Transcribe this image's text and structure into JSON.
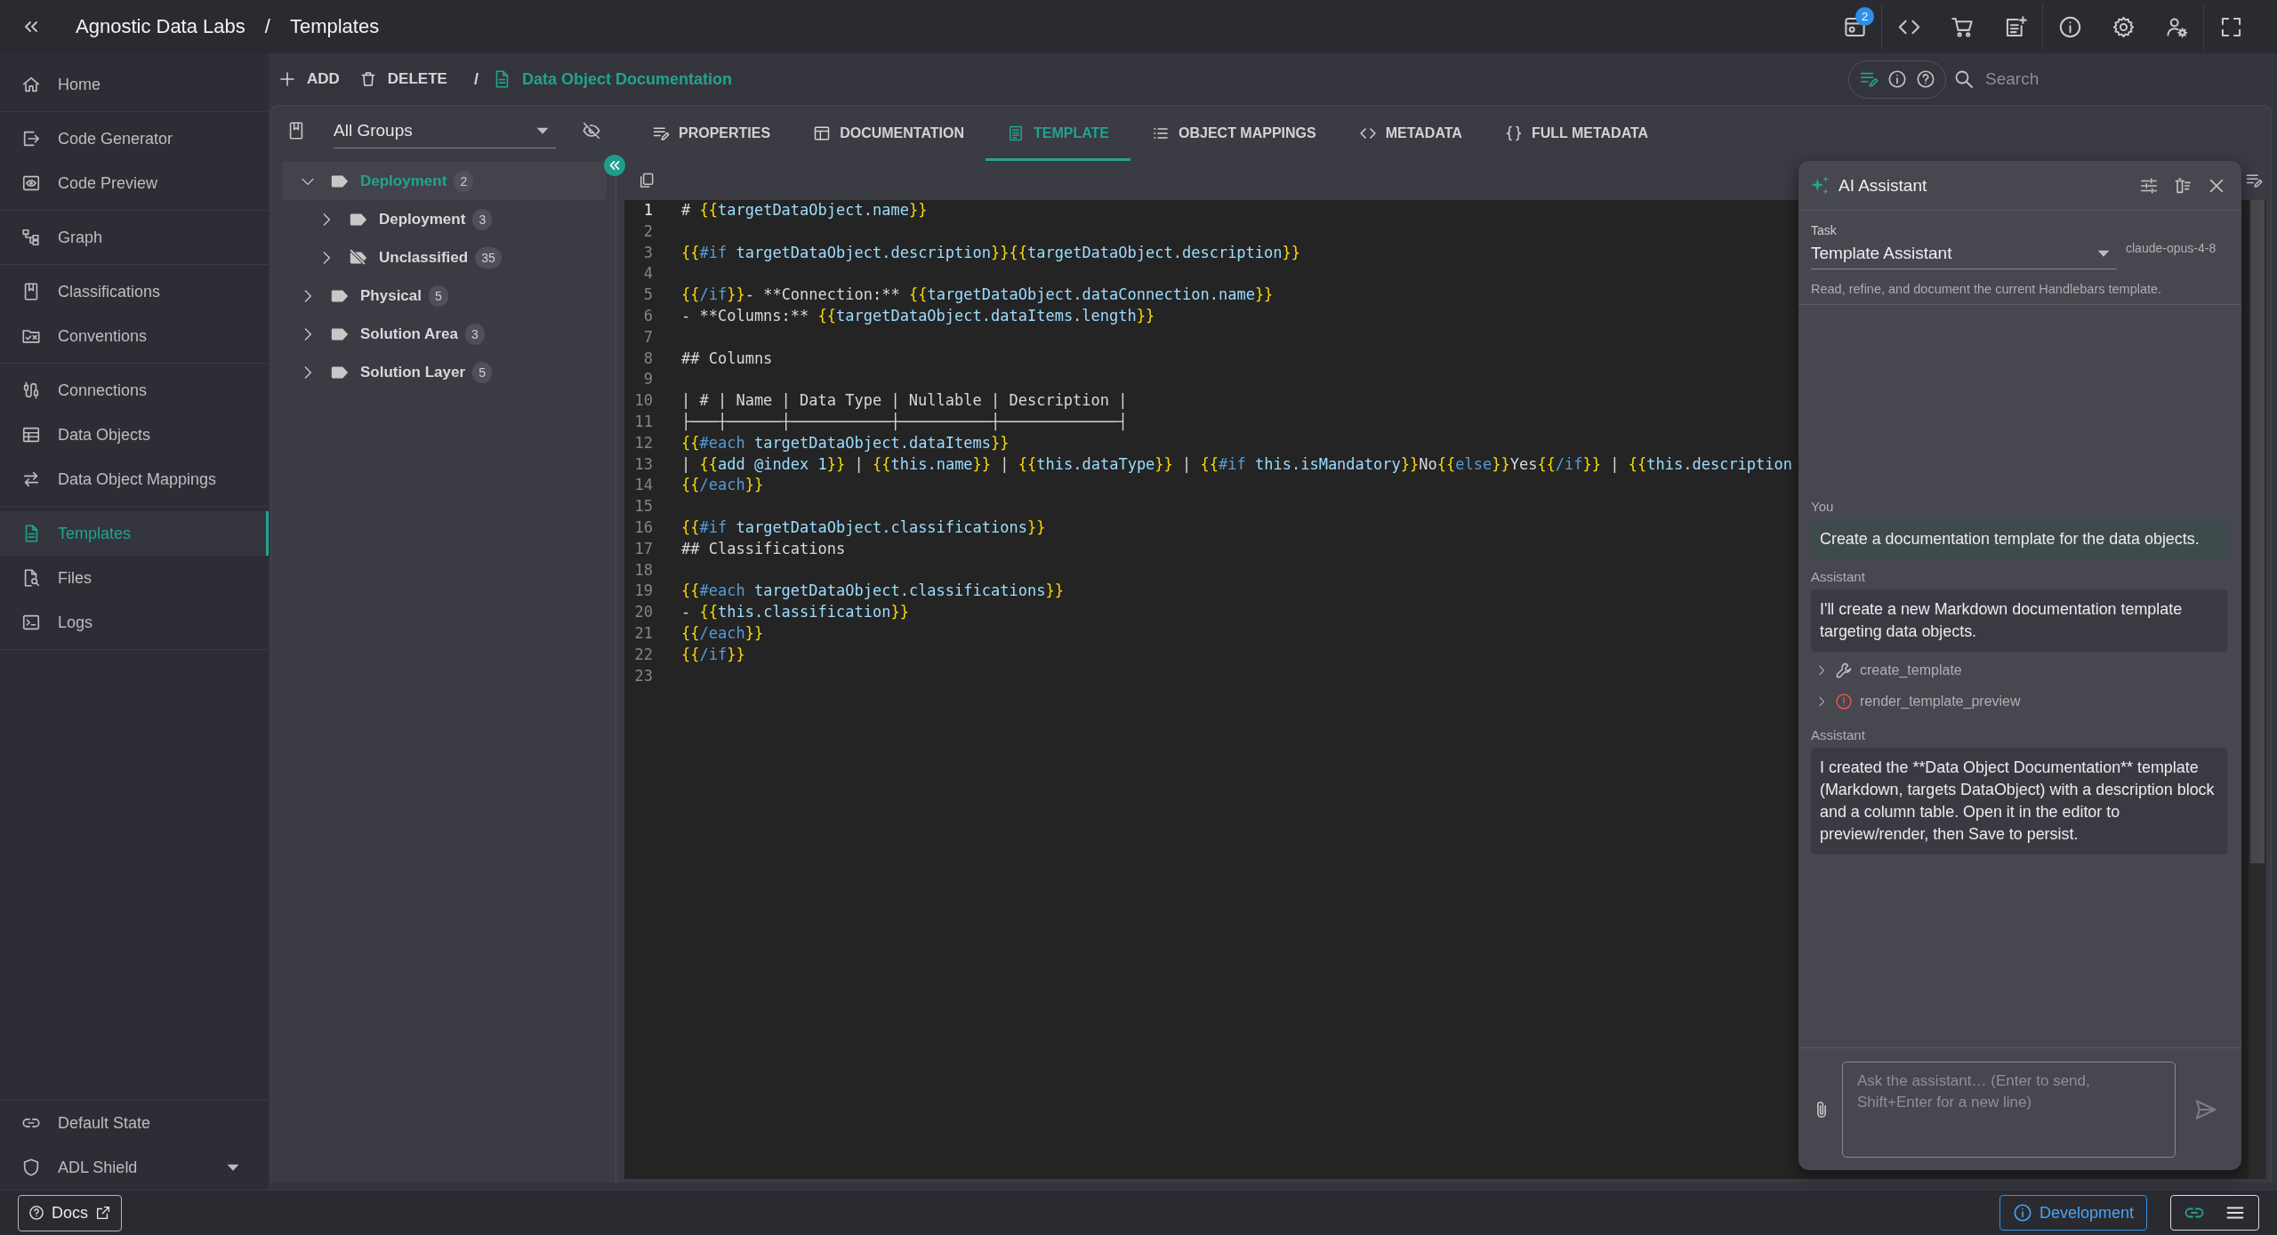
{
  "header": {
    "title": "Agnostic Data Labs",
    "separator": "/",
    "page": "Templates",
    "badge": "2"
  },
  "sidebar": {
    "groups": [
      {
        "items": [
          {
            "label": "Home",
            "selected": false
          }
        ]
      },
      {
        "items": [
          {
            "label": "Code Generator",
            "selected": false
          },
          {
            "label": "Code Preview",
            "selected": false
          }
        ]
      },
      {
        "items": [
          {
            "label": "Graph",
            "selected": false
          }
        ]
      },
      {
        "items": [
          {
            "label": "Classifications",
            "selected": false
          },
          {
            "label": "Conventions",
            "selected": false
          }
        ]
      },
      {
        "items": [
          {
            "label": "Connections",
            "selected": false
          },
          {
            "label": "Data Objects",
            "selected": false
          },
          {
            "label": "Data Object Mappings",
            "selected": false
          }
        ]
      },
      {
        "items": [
          {
            "label": "Templates",
            "selected": true
          },
          {
            "label": "Files",
            "selected": false
          },
          {
            "label": "Logs",
            "selected": false
          }
        ]
      }
    ],
    "footer": [
      {
        "label": "Default State",
        "kind": "link"
      },
      {
        "label": "ADL Shield",
        "kind": "select"
      }
    ]
  },
  "toolbar": {
    "add": "ADD",
    "delete": "DELETE",
    "separator": "/",
    "document": "Data Object Documentation",
    "search": {
      "placeholder": "Search"
    }
  },
  "tree": {
    "group_select": {
      "value": "All Groups"
    },
    "items": [
      {
        "label": "Deployment",
        "count": "2",
        "kind": "tag",
        "expanded": true,
        "selected": true,
        "children": [
          {
            "label": "Deployment",
            "count": "3",
            "kind": "tag",
            "expanded": false,
            "selected": false
          },
          {
            "label": "Unclassified",
            "count": "35",
            "kind": "untagged",
            "expanded": false,
            "selected": false
          }
        ]
      },
      {
        "label": "Physical",
        "count": "5",
        "kind": "tag",
        "expanded": false,
        "selected": false
      },
      {
        "label": "Solution Area",
        "count": "3",
        "kind": "tag",
        "expanded": false,
        "selected": false
      },
      {
        "label": "Solution Layer",
        "count": "5",
        "kind": "tag",
        "expanded": false,
        "selected": false
      }
    ]
  },
  "tabs": [
    {
      "label": "PROPERTIES",
      "selected": false
    },
    {
      "label": "DOCUMENTATION",
      "selected": false
    },
    {
      "label": "TEMPLATE",
      "selected": true
    },
    {
      "label": "OBJECT MAPPINGS",
      "selected": false
    },
    {
      "label": "METADATA",
      "selected": false
    },
    {
      "label": "FULL METADATA",
      "selected": false
    }
  ],
  "editor": {
    "lines": [
      {
        "number": "1",
        "current": true,
        "tokens": [
          {
            "kind": "text",
            "text": "# "
          },
          {
            "kind": "brace",
            "text": "{{"
          },
          {
            "kind": "expr",
            "text": "targetDataObject.name"
          },
          {
            "kind": "brace",
            "text": "}}"
          }
        ]
      },
      {
        "number": "2",
        "current": false
      },
      {
        "number": "3",
        "current": false,
        "tokens": [
          {
            "kind": "brace",
            "text": "{{"
          },
          {
            "kind": "keyword",
            "text": "#if"
          },
          {
            "kind": "expr",
            "text": " targetDataObject.description"
          },
          {
            "kind": "brace",
            "text": "}}{{"
          },
          {
            "kind": "expr",
            "text": "targetDataObject.description"
          },
          {
            "kind": "brace",
            "text": "}}"
          }
        ]
      },
      {
        "number": "4",
        "current": false
      },
      {
        "number": "5",
        "current": false,
        "tokens": [
          {
            "kind": "brace",
            "text": "{{"
          },
          {
            "kind": "keyword",
            "text": "/if"
          },
          {
            "kind": "brace",
            "text": "}}"
          },
          {
            "kind": "text",
            "text": "- **Connection:** "
          },
          {
            "kind": "brace",
            "text": "{{"
          },
          {
            "kind": "expr",
            "text": "targetDataObject.dataConnection.name"
          },
          {
            "kind": "brace",
            "text": "}}"
          }
        ]
      },
      {
        "number": "6",
        "current": false,
        "tokens": [
          {
            "kind": "text",
            "text": "- **Columns:** "
          },
          {
            "kind": "brace",
            "text": "{{"
          },
          {
            "kind": "expr",
            "text": "targetDataObject.dataItems.length"
          },
          {
            "kind": "brace",
            "text": "}}"
          }
        ]
      },
      {
        "number": "7",
        "current": false
      },
      {
        "number": "8",
        "current": false,
        "tokens": [
          {
            "kind": "text",
            "text": "## Columns"
          }
        ]
      },
      {
        "number": "9",
        "current": false
      },
      {
        "number": "10",
        "current": false,
        "tokens": [
          {
            "kind": "text",
            "text": "| # | Name | Data Type | Nullable | Description |"
          }
        ]
      },
      {
        "number": "11",
        "current": false,
        "tokens": [
          {
            "kind": "text",
            "text": "├───┼──────┼───────────┼──────────┼─────────────┤"
          }
        ]
      },
      {
        "number": "12",
        "current": false,
        "tokens": [
          {
            "kind": "brace",
            "text": "{{"
          },
          {
            "kind": "keyword",
            "text": "#each"
          },
          {
            "kind": "expr",
            "text": " targetDataObject.dataItems"
          },
          {
            "kind": "brace",
            "text": "}}"
          }
        ]
      },
      {
        "number": "13",
        "current": false,
        "tokens": [
          {
            "kind": "text",
            "text": "| "
          },
          {
            "kind": "brace",
            "text": "{{"
          },
          {
            "kind": "expr",
            "text": "add @index 1"
          },
          {
            "kind": "brace",
            "text": "}}"
          },
          {
            "kind": "text",
            "text": " | "
          },
          {
            "kind": "brace",
            "text": "{{"
          },
          {
            "kind": "expr",
            "text": "this.name"
          },
          {
            "kind": "brace",
            "text": "}}"
          },
          {
            "kind": "text",
            "text": " | "
          },
          {
            "kind": "brace",
            "text": "{{"
          },
          {
            "kind": "expr",
            "text": "this.dataType"
          },
          {
            "kind": "brace",
            "text": "}}"
          },
          {
            "kind": "text",
            "text": " | "
          },
          {
            "kind": "brace",
            "text": "{{"
          },
          {
            "kind": "keyword",
            "text": "#if"
          },
          {
            "kind": "expr",
            "text": " this.isMandatory"
          },
          {
            "kind": "brace",
            "text": "}}"
          },
          {
            "kind": "text",
            "text": "No"
          },
          {
            "kind": "brace",
            "text": "{{"
          },
          {
            "kind": "keyword",
            "text": "else"
          },
          {
            "kind": "brace",
            "text": "}}"
          },
          {
            "kind": "text",
            "text": "Yes"
          },
          {
            "kind": "brace",
            "text": "{{"
          },
          {
            "kind": "keyword",
            "text": "/if"
          },
          {
            "kind": "brace",
            "text": "}}"
          },
          {
            "kind": "text",
            "text": " | "
          },
          {
            "kind": "brace",
            "text": "{{"
          },
          {
            "kind": "expr",
            "text": "this.description"
          }
        ]
      },
      {
        "number": "14",
        "current": false,
        "tokens": [
          {
            "kind": "brace",
            "text": "{{"
          },
          {
            "kind": "keyword",
            "text": "/each"
          },
          {
            "kind": "brace",
            "text": "}}"
          }
        ]
      },
      {
        "number": "15",
        "current": false
      },
      {
        "number": "16",
        "current": false,
        "tokens": [
          {
            "kind": "brace",
            "text": "{{"
          },
          {
            "kind": "keyword",
            "text": "#if"
          },
          {
            "kind": "expr",
            "text": " targetDataObject.classifications"
          },
          {
            "kind": "brace",
            "text": "}}"
          }
        ]
      },
      {
        "number": "17",
        "current": false,
        "tokens": [
          {
            "kind": "text",
            "text": "## Classifications"
          }
        ]
      },
      {
        "number": "18",
        "current": false
      },
      {
        "number": "19",
        "current": false,
        "tokens": [
          {
            "kind": "brace",
            "text": "{{"
          },
          {
            "kind": "keyword",
            "text": "#each"
          },
          {
            "kind": "expr",
            "text": " targetDataObject.classifications"
          },
          {
            "kind": "brace",
            "text": "}}"
          }
        ]
      },
      {
        "number": "20",
        "current": false,
        "tokens": [
          {
            "kind": "text",
            "text": "- "
          },
          {
            "kind": "brace",
            "text": "{{"
          },
          {
            "kind": "expr",
            "text": "this.classification"
          },
          {
            "kind": "brace",
            "text": "}}"
          }
        ]
      },
      {
        "number": "21",
        "current": false,
        "tokens": [
          {
            "kind": "brace",
            "text": "{{"
          },
          {
            "kind": "keyword",
            "text": "/each"
          },
          {
            "kind": "brace",
            "text": "}}"
          }
        ]
      },
      {
        "number": "22",
        "current": false,
        "tokens": [
          {
            "kind": "brace",
            "text": "{{"
          },
          {
            "kind": "keyword",
            "text": "/if"
          },
          {
            "kind": "brace",
            "text": "}}"
          }
        ]
      },
      {
        "number": "23",
        "current": false
      }
    ]
  },
  "assistant": {
    "title": "AI Assistant",
    "task": {
      "label": "Task",
      "value": "Template Assistant"
    },
    "model": "claude-opus-4-8",
    "description": "Read, refine, and document the current Handlebars template.",
    "messages": [
      {
        "kind": "user",
        "author": "You",
        "text": "Create a documentation template for the data objects."
      },
      {
        "kind": "assistant",
        "author": "Assistant",
        "text": "I'll create a new Markdown documentation template targeting data objects.",
        "tools": [
          {
            "name": "create_template",
            "kind": "success",
            "expanded": false
          },
          {
            "name": "render_template_preview",
            "kind": "error",
            "expanded": false
          }
        ]
      },
      {
        "kind": "assistant",
        "author": "Assistant",
        "text": "I created the **Data Object Documentation** template (Markdown, targets DataObject) with a description block and a column table. Open it in the editor to preview/render, then Save to persist."
      }
    ],
    "input": {
      "placeholder": "Ask the assistant… (Enter to send, Shift+Enter for a new line)"
    },
    "send": {
      "disabled": true
    }
  },
  "status_bar": {
    "docs": "Docs",
    "environment": "Development",
    "view_modes": [
      {
        "selected": true
      },
      {
        "selected": false
      }
    ]
  }
}
